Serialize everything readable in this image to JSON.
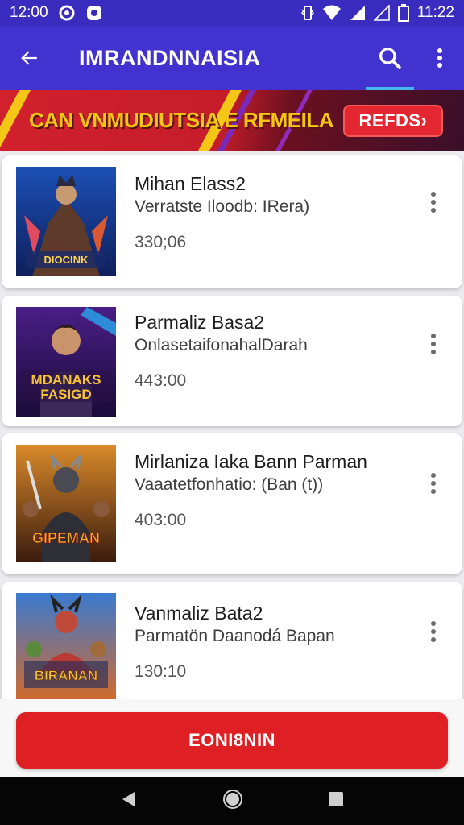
{
  "status_bar": {
    "time_left": "12:00",
    "time_right": "11:22"
  },
  "app_bar": {
    "title": "IMRANDNNAISIA"
  },
  "banner": {
    "text": "CAN VNMUDIUTSIA E RFMEILA",
    "cta_label": "REFDS›"
  },
  "items": [
    {
      "title": "Mihan Elass2",
      "subtitle": "Verratste Iloodb: IRera)",
      "price": "330;06"
    },
    {
      "title": "Parmaliz Basa2",
      "subtitle": "OnlasetaifonahalDarah",
      "price": "443:00"
    },
    {
      "title": "Mirlaniza Iaka Bann Parman",
      "subtitle": "Vaaatetfonhatio: (Ban (t))",
      "price": "403:00"
    },
    {
      "title": "Vanmaliz Bata2",
      "subtitle": "Parmatön Daanodá Bapan",
      "price": "130:10"
    }
  ],
  "bottom_button": {
    "label": "EONI8NIN"
  },
  "icons": {
    "back": "arrow-left-icon",
    "search": "search-icon",
    "more": "more-vert-icon",
    "nav_back": "nav-back-icon",
    "nav_home": "nav-home-icon",
    "nav_recents": "nav-recents-icon"
  },
  "colors": {
    "status_bar": "#3a2cbe",
    "app_bar": "#4232cf",
    "tab_indicator": "#46b9f0",
    "banner": "#d1212c",
    "primary_button": "#de2025"
  }
}
